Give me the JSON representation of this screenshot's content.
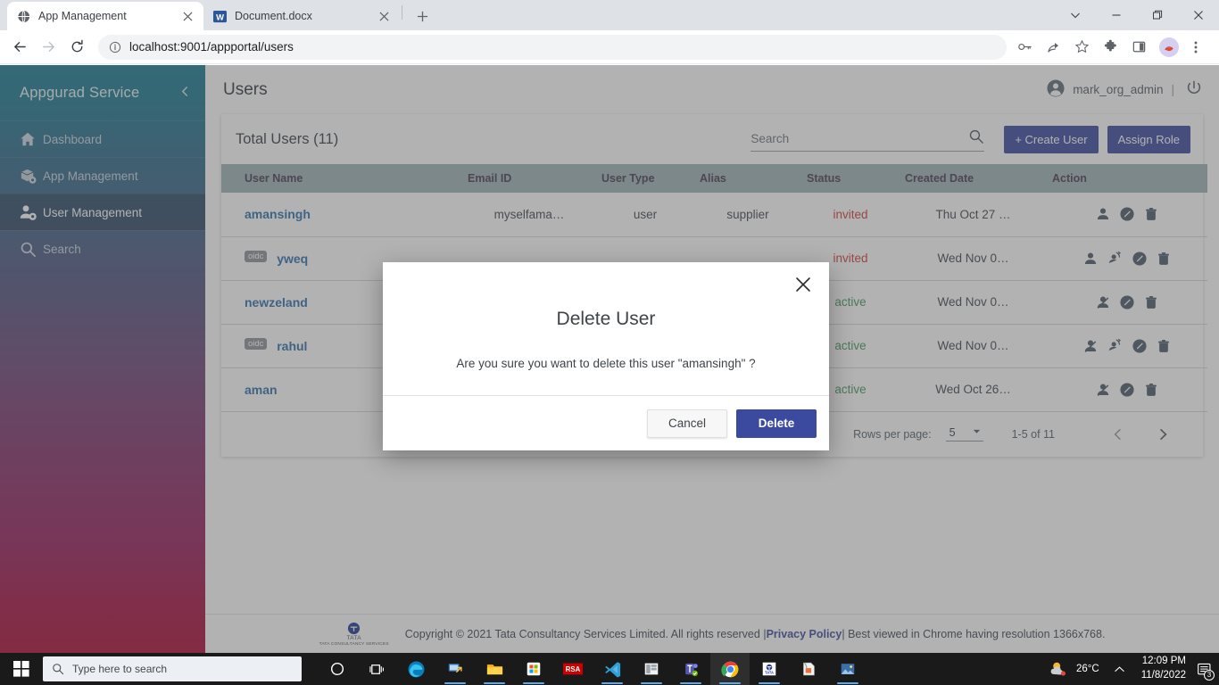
{
  "browser": {
    "tabs": [
      {
        "title": "App Management",
        "favicon": "globe-icon",
        "active": true
      },
      {
        "title": "Document.docx",
        "favicon": "word-icon",
        "active": false
      }
    ],
    "new_tab_label": "+",
    "window_controls": [
      "chevron-down",
      "minimize",
      "maximize",
      "close"
    ],
    "url": "localhost:9001/appportal/users",
    "nav": {
      "back": "back-arrow",
      "forward": "forward-arrow",
      "reload": "reload-icon"
    }
  },
  "sidebar": {
    "title": "Appgurad Service",
    "collapse_icon": "chevron-left-icon",
    "items": [
      {
        "label": "Dashboard",
        "icon": "home-icon",
        "active": false
      },
      {
        "label": "App Management",
        "icon": "box-gear-icon",
        "active": false
      },
      {
        "label": "User Management",
        "icon": "user-gear-icon",
        "active": true
      },
      {
        "label": "Search",
        "icon": "search-icon",
        "active": false
      }
    ]
  },
  "topbar": {
    "page_title": "Users",
    "user_name": "mark_org_admin",
    "separator": "|",
    "logout_icon": "power-icon"
  },
  "card": {
    "total_users": "Total Users (11)",
    "search_placeholder": "Search",
    "search_value": "",
    "create_user_label": "+ Create User",
    "assign_role_label": "Assign Role"
  },
  "table": {
    "columns": [
      "User Name",
      "Email ID",
      "User Type",
      "Alias",
      "Status",
      "Created Date",
      "Action"
    ],
    "rows": [
      {
        "badge": "",
        "user_name": "amansingh",
        "email": "myselfama…",
        "user_type": "user",
        "alias": "supplier",
        "status": "invited",
        "created_date": "Thu Oct 27 …",
        "actions": [
          "user-icon",
          "edit-icon",
          "delete-icon"
        ]
      },
      {
        "badge": "oidc",
        "user_name": "yweq",
        "email": "",
        "user_type": "",
        "alias": "",
        "status": "invited",
        "created_date": "Wed Nov 0…",
        "actions": [
          "user-icon",
          "resend-invite-icon",
          "edit-icon",
          "delete-icon"
        ]
      },
      {
        "badge": "",
        "user_name": "newzeland",
        "email": "",
        "user_type": "",
        "alias": "",
        "status": "active",
        "created_date": "Wed Nov 0…",
        "actions": [
          "user-disable-icon",
          "edit-icon",
          "delete-icon"
        ]
      },
      {
        "badge": "oidc",
        "user_name": "rahul",
        "email": "",
        "user_type": "",
        "alias": "",
        "status": "active",
        "created_date": "Wed Nov 0…",
        "actions": [
          "user-disable-icon",
          "resend-invite-icon",
          "edit-icon",
          "delete-icon"
        ]
      },
      {
        "badge": "",
        "user_name": "aman",
        "email": "",
        "user_type": "",
        "alias": "",
        "status": "active",
        "created_date": "Wed Oct 26…",
        "actions": [
          "user-disable-icon",
          "edit-icon",
          "delete-icon"
        ]
      }
    ]
  },
  "pagination": {
    "rows_per_page_label": "Rows per page:",
    "rows_per_page_value": "5",
    "range": "1-5 of 11",
    "prev_icon": "chevron-left-icon",
    "next_icon": "chevron-right-icon"
  },
  "footer": {
    "logo_word": "TATA",
    "logo_sub": "TATA CONSULTANCY SERVICES",
    "text_before": "Copyright © 2021 Tata Consultancy Services Limited. All rights reserved | ",
    "privacy_link": "Privacy Policy",
    "text_after": " | Best viewed in Chrome having resolution 1366x768."
  },
  "modal": {
    "title": "Delete User",
    "message": "Are you sure you want to delete this user \"amansingh\" ?",
    "cancel_label": "Cancel",
    "delete_label": "Delete",
    "close_icon": "close-icon"
  },
  "taskbar": {
    "start_icon": "windows-icon",
    "search_placeholder": "Type here to search",
    "apps": [
      "cortana-icon",
      "task-view-icon",
      "edge-icon",
      "remote-desktop-icon",
      "file-explorer-icon",
      "microsoft-store-icon",
      "rsa-icon",
      "vscode-icon",
      "app-icon",
      "teams-icon",
      "chrome-icon",
      "tata-icon",
      "archive-icon",
      "photos-icon"
    ],
    "temperature": "26°C",
    "weather_icon": "sun-cloud-icon",
    "tray_chevron": "chevron-up-icon",
    "time": "12:09 PM",
    "date": "11/8/2022",
    "notification_count": "3"
  },
  "colors": {
    "accent": "#3b4a9e",
    "status_invited": "#cf3c36",
    "status_active": "#3f9a5e",
    "username_link": "#2f6fae",
    "table_header_bg": "#9fb3b6"
  }
}
